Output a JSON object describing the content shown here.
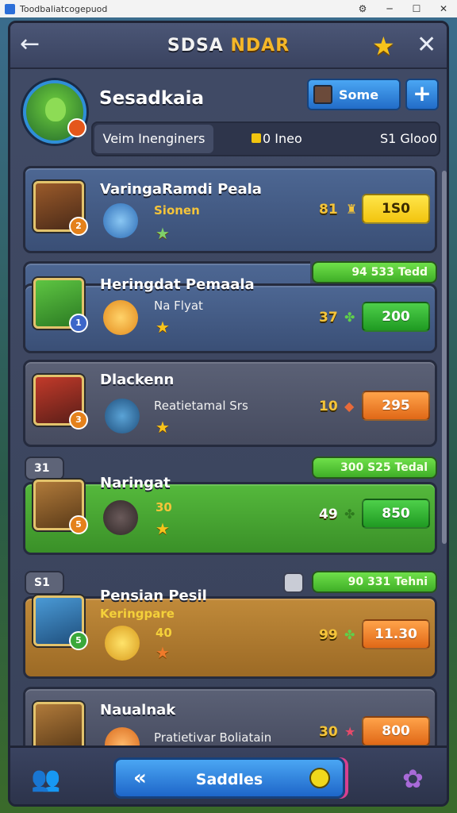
{
  "window": {
    "title": "Toodbaliatcogepuod"
  },
  "header": {
    "title_part1": "SDSA",
    "title_part2": "NDAR"
  },
  "profile": {
    "name": "Sesadkaia",
    "some_button": "Some",
    "plus_button": "+",
    "tag": "Veim Inenginers",
    "coins": "0 Ineo",
    "gold": "S1 Gloo0"
  },
  "entries": [
    {
      "name": "VaringaRamdi Peala",
      "sub": "Sionen",
      "score": "81",
      "price": "1S0",
      "color": "blue"
    },
    {
      "name": "Heringdat Pemaala",
      "sub": "Na Flyat",
      "score": "37",
      "price": "200",
      "pill": "94 533 Tedd",
      "color": "blue"
    },
    {
      "name": "Dlackenn",
      "sub": "Reatietamal Srs",
      "score": "10",
      "price": "295",
      "color": "dark"
    },
    {
      "name": "Naringat",
      "sub": "30",
      "score": "49",
      "price": "850",
      "rank": "31",
      "pill": "300 S25 Tedal",
      "color": "green"
    },
    {
      "name": "Pensian Pesil",
      "sub": "Keringpare",
      "sub2": "40",
      "score": "99",
      "price": "11.30",
      "rank": "S1",
      "pill": "90 331 Tehni",
      "color": "orange"
    },
    {
      "name": "Naualnak",
      "sub": "Pratietivar Boliatain",
      "score": "30",
      "price": "800",
      "color": "dark"
    }
  ],
  "bottom": {
    "main_label": "Saddles"
  },
  "icons": {
    "back": "arrow-left-icon",
    "star": "star-icon",
    "close": "close-icon",
    "friends": "friends-icon",
    "settings": "settings-icon"
  }
}
